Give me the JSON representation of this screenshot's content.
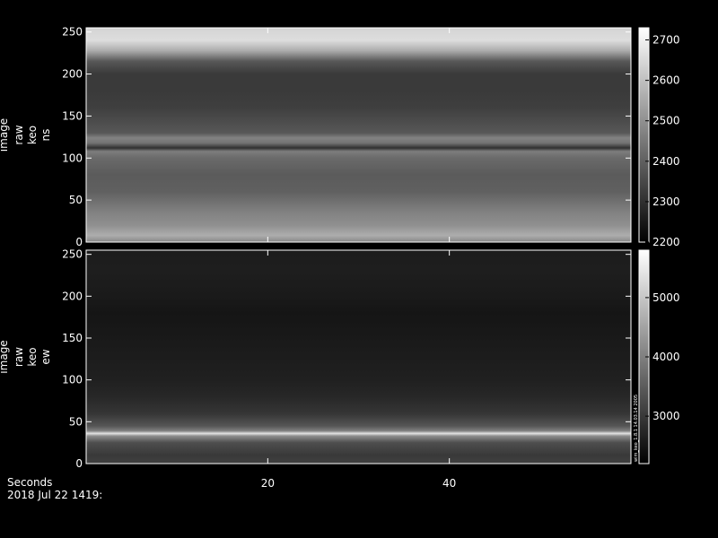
{
  "chart_data": [
    {
      "type": "heatmap",
      "ylabel_lines": [
        "image",
        "raw",
        "keo",
        "ns"
      ],
      "ylim": [
        0,
        255
      ],
      "yticks": [
        0,
        50,
        100,
        150,
        200,
        250
      ],
      "xlim": [
        0,
        60
      ],
      "colorbar": {
        "ticks": [
          2200,
          2300,
          2400,
          2500,
          2600,
          2700
        ],
        "range": [
          2200,
          2730
        ]
      },
      "profile": [
        {
          "y": 0,
          "v": 2480
        },
        {
          "y": 8,
          "v": 2560
        },
        {
          "y": 20,
          "v": 2500
        },
        {
          "y": 35,
          "v": 2470
        },
        {
          "y": 60,
          "v": 2400
        },
        {
          "y": 80,
          "v": 2390
        },
        {
          "y": 100,
          "v": 2420
        },
        {
          "y": 108,
          "v": 2460
        },
        {
          "y": 112,
          "v": 2300
        },
        {
          "y": 118,
          "v": 2440
        },
        {
          "y": 124,
          "v": 2470
        },
        {
          "y": 130,
          "v": 2380
        },
        {
          "y": 160,
          "v": 2330
        },
        {
          "y": 180,
          "v": 2320
        },
        {
          "y": 200,
          "v": 2320
        },
        {
          "y": 215,
          "v": 2380
        },
        {
          "y": 228,
          "v": 2560
        },
        {
          "y": 240,
          "v": 2660
        },
        {
          "y": 255,
          "v": 2640
        }
      ]
    },
    {
      "type": "heatmap",
      "ylabel_lines": [
        "image",
        "raw",
        "keo",
        "ew"
      ],
      "ylim": [
        0,
        255
      ],
      "yticks": [
        0,
        50,
        100,
        150,
        200,
        250
      ],
      "xlim": [
        0,
        60
      ],
      "colorbar": {
        "ticks": [
          3000,
          4000,
          5000
        ],
        "range": [
          2200,
          5800
        ],
        "side_label": "wim_keo_1.8.1 14.03.14 2005"
      },
      "profile": [
        {
          "y": 0,
          "v": 3100
        },
        {
          "y": 10,
          "v": 3000
        },
        {
          "y": 25,
          "v": 3300
        },
        {
          "y": 33,
          "v": 4200
        },
        {
          "y": 36,
          "v": 5400
        },
        {
          "y": 39,
          "v": 4000
        },
        {
          "y": 45,
          "v": 3400
        },
        {
          "y": 60,
          "v": 2950
        },
        {
          "y": 80,
          "v": 2750
        },
        {
          "y": 100,
          "v": 2650
        },
        {
          "y": 150,
          "v": 2550
        },
        {
          "y": 180,
          "v": 2500
        },
        {
          "y": 200,
          "v": 2560
        },
        {
          "y": 230,
          "v": 2620
        },
        {
          "y": 255,
          "v": 2600
        }
      ]
    }
  ],
  "xaxis": {
    "label": "Seconds",
    "ticks": [
      20,
      40
    ]
  },
  "footer_date": "2018 Jul 22 1419:"
}
